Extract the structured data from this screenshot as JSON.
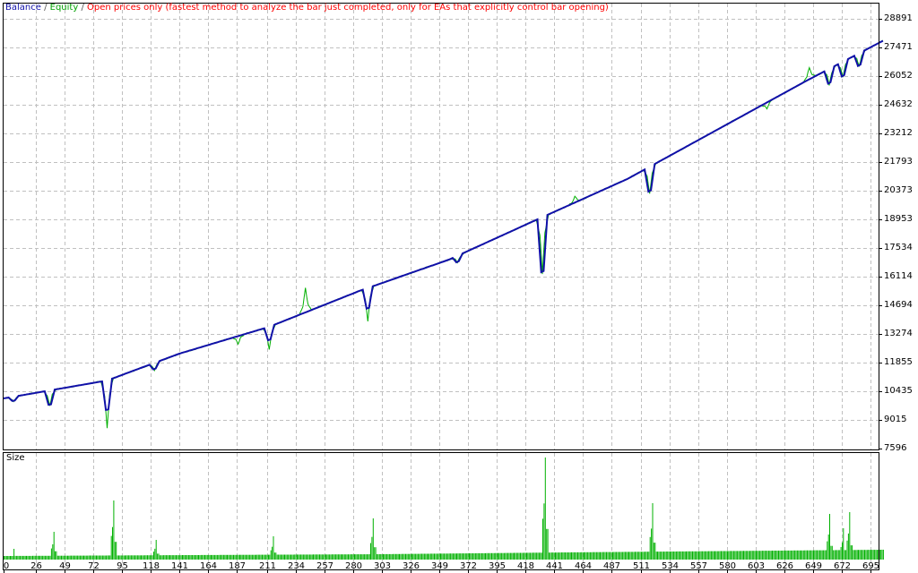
{
  "chart_data": {
    "type": "line",
    "legend": {
      "balance": "Balance",
      "equity": "Equity",
      "separator": "/",
      "mode": "Open prices only (fastest method to analyze the bar just completed, only for EAs that explicitly control bar opening)"
    },
    "colors": {
      "balance": "#1010a8",
      "equity": "#00b000",
      "mode": "#ff0000",
      "size": "#00b000",
      "grid": "#c0c0c0"
    },
    "ylim": [
      7596,
      28891
    ],
    "y_ticks": [
      "28891",
      "27471",
      "26052",
      "24632",
      "23212",
      "21793",
      "20373",
      "18953",
      "17534",
      "16114",
      "14694",
      "13274",
      "11855",
      "10435",
      "9015",
      "7596"
    ],
    "x_ticks": [
      "0",
      "26",
      "49",
      "72",
      "95",
      "118",
      "141",
      "164",
      "187",
      "211",
      "234",
      "257",
      "280",
      "303",
      "326",
      "349",
      "372",
      "395",
      "418",
      "441",
      "464",
      "487",
      "511",
      "534",
      "557",
      "580",
      "603",
      "626",
      "649",
      "672",
      "695"
    ],
    "xlim": [
      0,
      705
    ],
    "balance_trend": [
      [
        0,
        10080
      ],
      [
        83,
        10968
      ],
      [
        141,
        12300
      ],
      [
        213,
        13630
      ],
      [
        285,
        15400
      ],
      [
        357,
        16956
      ],
      [
        428,
        18953
      ],
      [
        500,
        20950
      ],
      [
        572,
        23390
      ],
      [
        644,
        25830
      ],
      [
        705,
        27800
      ]
    ],
    "excursions": [
      {
        "trade": 8,
        "balance": -200,
        "equity": -250
      },
      {
        "trade": 37,
        "balance": -700,
        "equity": -750
      },
      {
        "trade": 83,
        "balance": -1450,
        "equity": -2350
      },
      {
        "trade": 121,
        "balance": -300,
        "equity": -350
      },
      {
        "trade": 188,
        "balance": 0,
        "equity": -400
      },
      {
        "trade": 213,
        "balance": -650,
        "equity": -1150
      },
      {
        "trade": 242,
        "balance": 0,
        "equity": 1200
      },
      {
        "trade": 292,
        "balance": -1000,
        "equity": -1650
      },
      {
        "trade": 364,
        "balance": -300,
        "equity": -350
      },
      {
        "trade": 432,
        "balance": -2700,
        "equity": -2800
      },
      {
        "trade": 458,
        "balance": 0,
        "equity": 300
      },
      {
        "trade": 518,
        "balance": -1200,
        "equity": -1350
      },
      {
        "trade": 612,
        "balance": 0,
        "equity": -300
      },
      {
        "trade": 646,
        "balance": 0,
        "equity": 600
      },
      {
        "trade": 662,
        "balance": -700,
        "equity": -800
      },
      {
        "trade": 673,
        "balance": -700,
        "equity": -750
      },
      {
        "trade": 686,
        "balance": -600,
        "equity": -650
      }
    ],
    "size_panel": {
      "label": "Size",
      "ylim": [
        0,
        1.2
      ],
      "base": [
        [
          0,
          0.04
        ],
        [
          300,
          0.06
        ],
        [
          450,
          0.08
        ],
        [
          705,
          0.11
        ]
      ],
      "spikes": [
        [
          8,
          0.12
        ],
        [
          40,
          0.31
        ],
        [
          88,
          0.66
        ],
        [
          122,
          0.22
        ],
        [
          216,
          0.26
        ],
        [
          296,
          0.46
        ],
        [
          434,
          1.14
        ],
        [
          520,
          0.63
        ],
        [
          662,
          0.51
        ],
        [
          673,
          0.35
        ],
        [
          678,
          0.53
        ]
      ]
    }
  }
}
